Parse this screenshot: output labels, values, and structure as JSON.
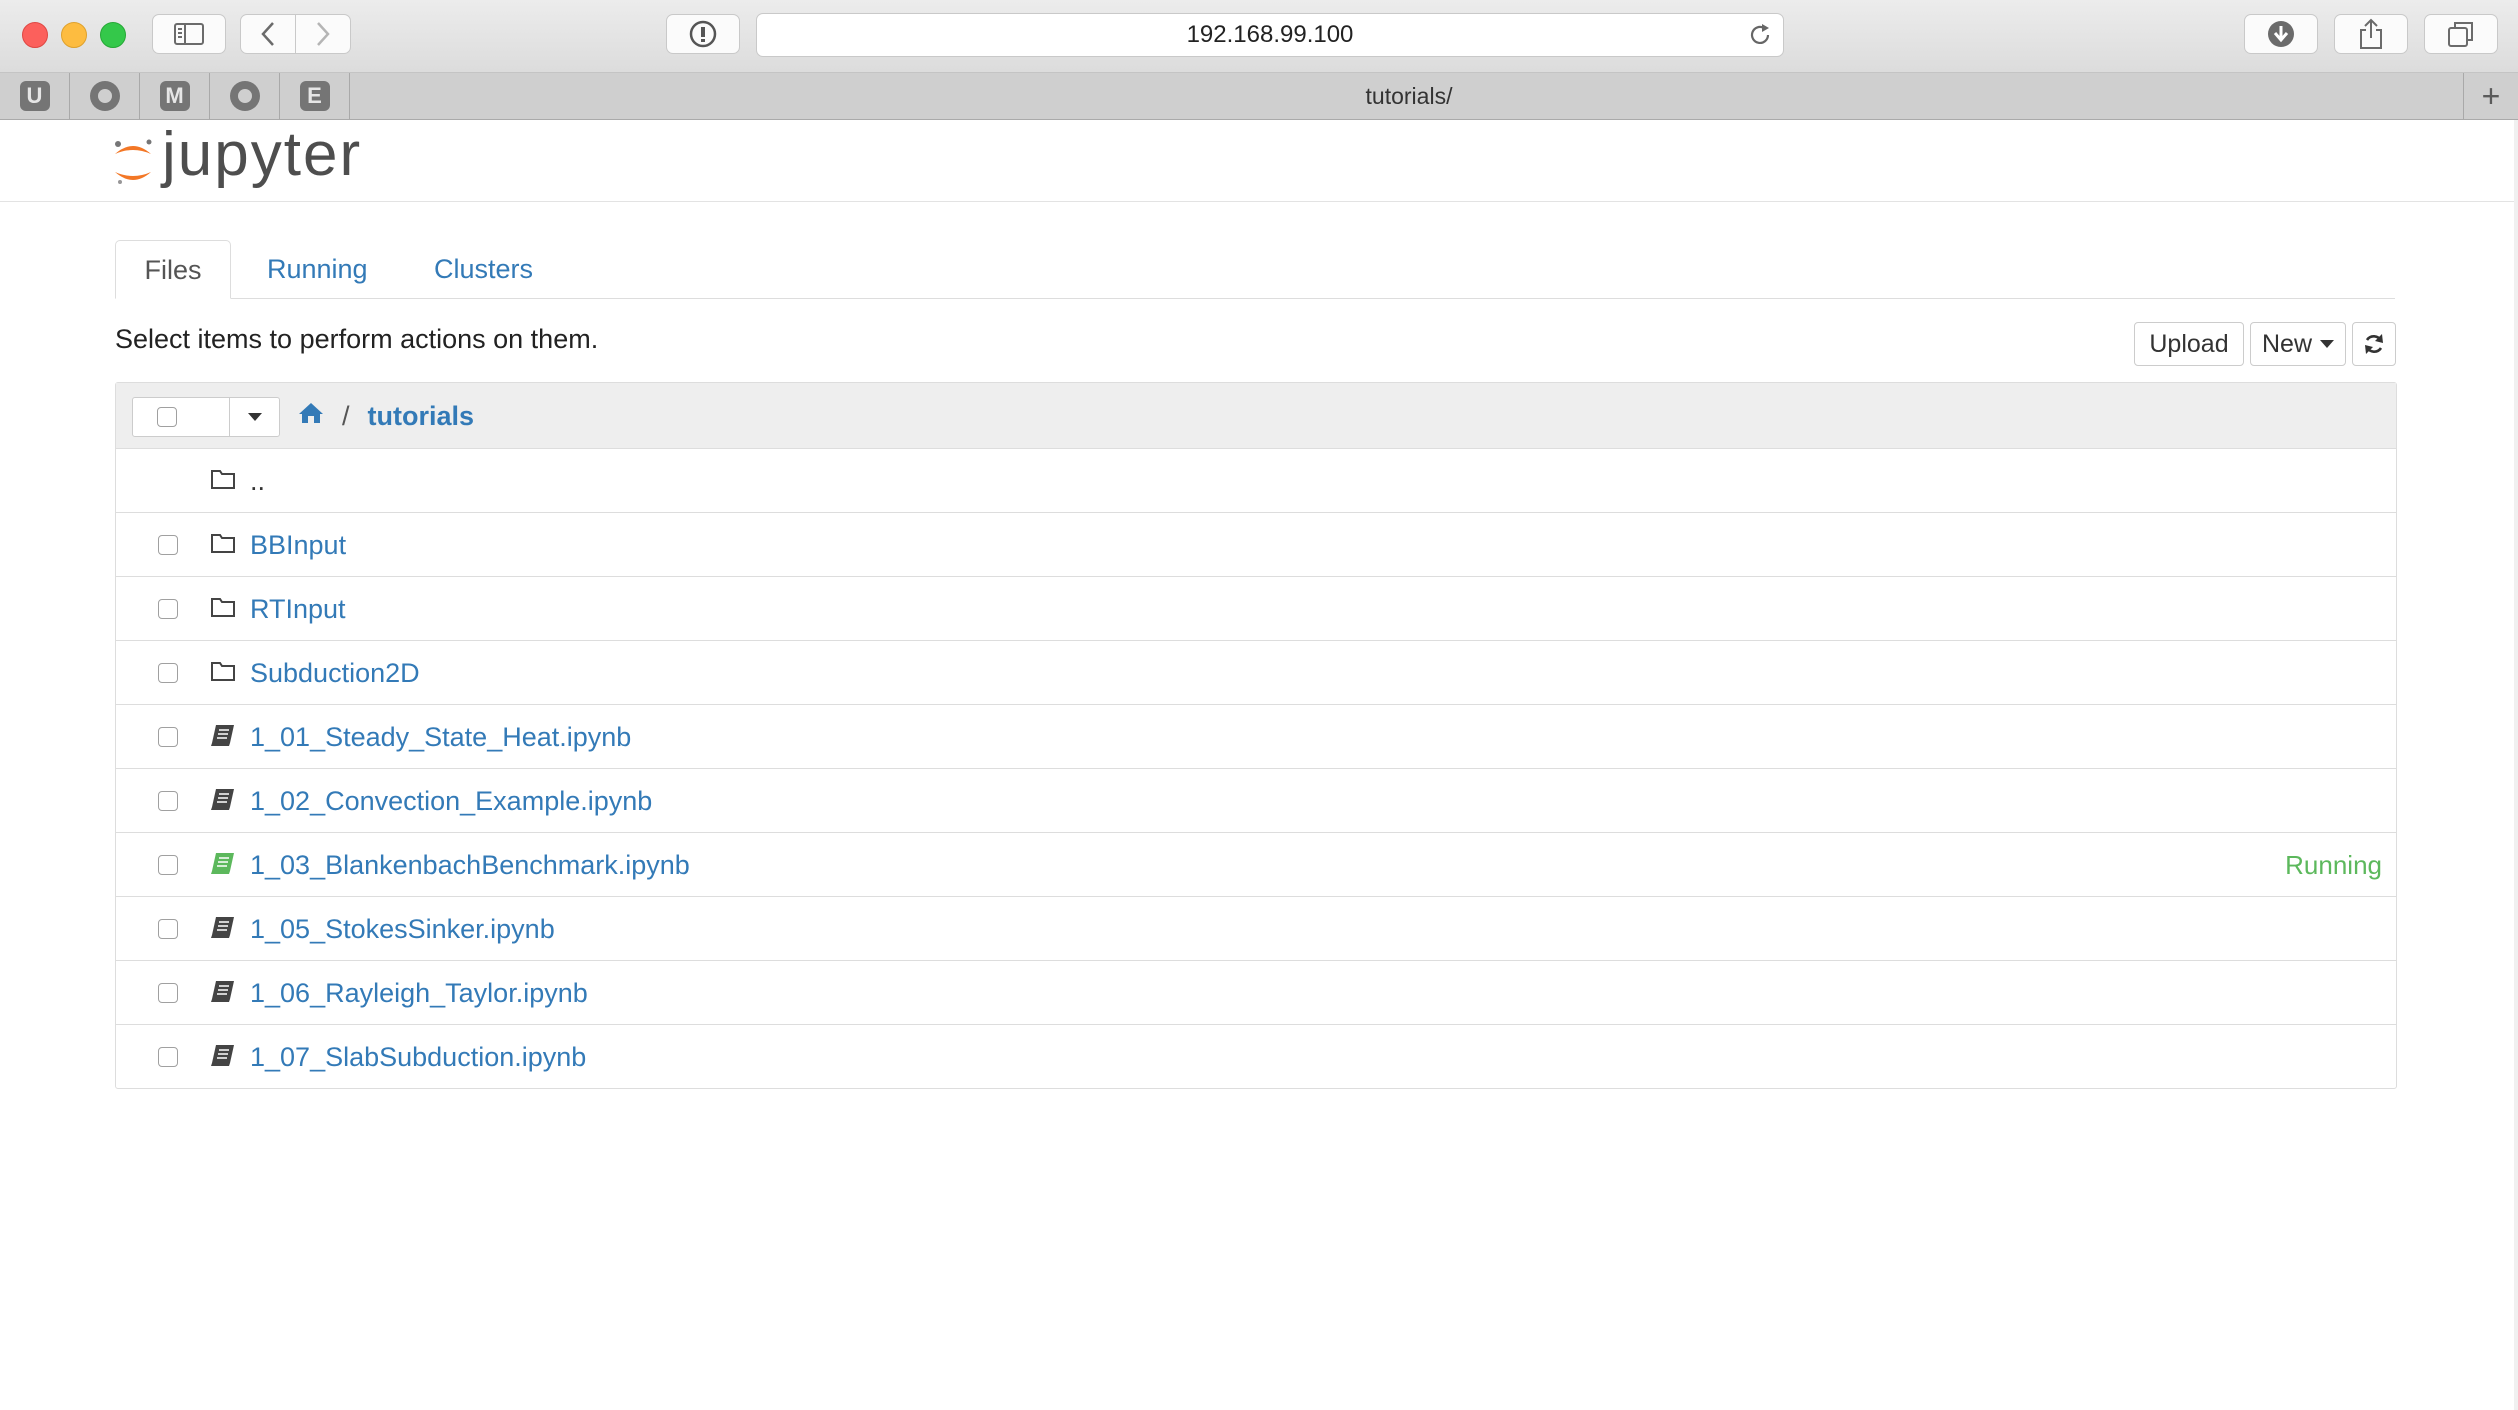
{
  "browser": {
    "url": "192.168.99.100",
    "tab_title": "tutorials/",
    "favorites": [
      {
        "kind": "letter",
        "label": "U",
        "icon": "u-favicon"
      },
      {
        "kind": "github",
        "label": "",
        "icon": "github-icon"
      },
      {
        "kind": "letter",
        "label": "M",
        "icon": "m-favicon"
      },
      {
        "kind": "github",
        "label": "",
        "icon": "github-icon"
      },
      {
        "kind": "letter",
        "label": "E",
        "icon": "e-favicon"
      }
    ]
  },
  "header": {
    "logo_text": "jupyter"
  },
  "tabs": [
    {
      "label": "Files",
      "active": true
    },
    {
      "label": "Running",
      "active": false
    },
    {
      "label": "Clusters",
      "active": false
    }
  ],
  "toolbar": {
    "hint": "Select items to perform actions on them.",
    "upload_label": "Upload",
    "new_label": "New"
  },
  "breadcrumb": {
    "separator": "/",
    "current": "tutorials"
  },
  "files": [
    {
      "name": "..",
      "type": "parent",
      "status": ""
    },
    {
      "name": "BBInput",
      "type": "folder",
      "status": ""
    },
    {
      "name": "RTInput",
      "type": "folder",
      "status": ""
    },
    {
      "name": "Subduction2D",
      "type": "folder",
      "status": ""
    },
    {
      "name": "1_01_Steady_State_Heat.ipynb",
      "type": "notebook",
      "status": ""
    },
    {
      "name": "1_02_Convection_Example.ipynb",
      "type": "notebook",
      "status": ""
    },
    {
      "name": "1_03_BlankenbachBenchmark.ipynb",
      "type": "notebook-running",
      "status": "Running"
    },
    {
      "name": "1_05_StokesSinker.ipynb",
      "type": "notebook",
      "status": ""
    },
    {
      "name": "1_06_Rayleigh_Taylor.ipynb",
      "type": "notebook",
      "status": ""
    },
    {
      "name": "1_07_SlabSubduction.ipynb",
      "type": "notebook",
      "status": ""
    }
  ],
  "colors": {
    "link": "#337ab7",
    "running": "#5cb85c",
    "logo_orange": "#f37726"
  }
}
